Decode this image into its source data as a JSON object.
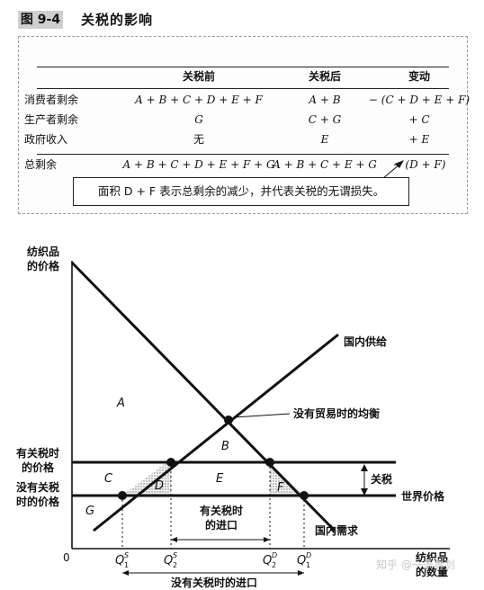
{
  "figure": {
    "number": "图 9-4",
    "title": "关税的影响"
  },
  "table": {
    "headers": [
      "",
      "关税前",
      "关税后",
      "变动"
    ],
    "rows": [
      [
        "消费者剩余",
        "A + B + C + D + E + F",
        "A + B",
        "− (C + D + E + F)"
      ],
      [
        "生产者剩余",
        "G",
        "C + G",
        "+ C"
      ],
      [
        "政府收入",
        "无",
        "E",
        "+ E"
      ],
      [
        "总剩余",
        "A + B + C + D + E + F + G",
        "A + B + C + E + G",
        "− (D + F)"
      ]
    ],
    "note": "面积 D + F 表示总剩余的减少，并代表关税的无谓损失。"
  },
  "graph": {
    "y_axis_label_line1": "纺织品",
    "y_axis_label_line2": "的价格",
    "x_axis_label_line1": "纺织品",
    "x_axis_label_line2": "的数量",
    "origin": "0",
    "price_with_tariff_line1": "有关税时",
    "price_with_tariff_line2": "的价格",
    "price_without_tariff_line1": "没有关税",
    "price_without_tariff_line2": "时的价格",
    "domestic_supply": "国内供给",
    "domestic_demand": "国内需求",
    "world_price": "世界价格",
    "tariff": "关税",
    "equilibrium_no_trade": "没有贸易时的均衡",
    "imports_with_tariff_line1": "有关税时",
    "imports_with_tariff_line2": "的进口",
    "imports_without_tariff": "没有关税时的进口",
    "areas": [
      "A",
      "B",
      "C",
      "D",
      "E",
      "F",
      "G"
    ],
    "x_ticks": [
      {
        "base": "Q",
        "sup": "S",
        "sub": "1"
      },
      {
        "base": "Q",
        "sup": "S",
        "sub": "2"
      },
      {
        "base": "Q",
        "sup": "D",
        "sub": "2"
      },
      {
        "base": "Q",
        "sup": "D",
        "sub": "1"
      }
    ],
    "watermark": "知乎 @一条青剑"
  }
}
